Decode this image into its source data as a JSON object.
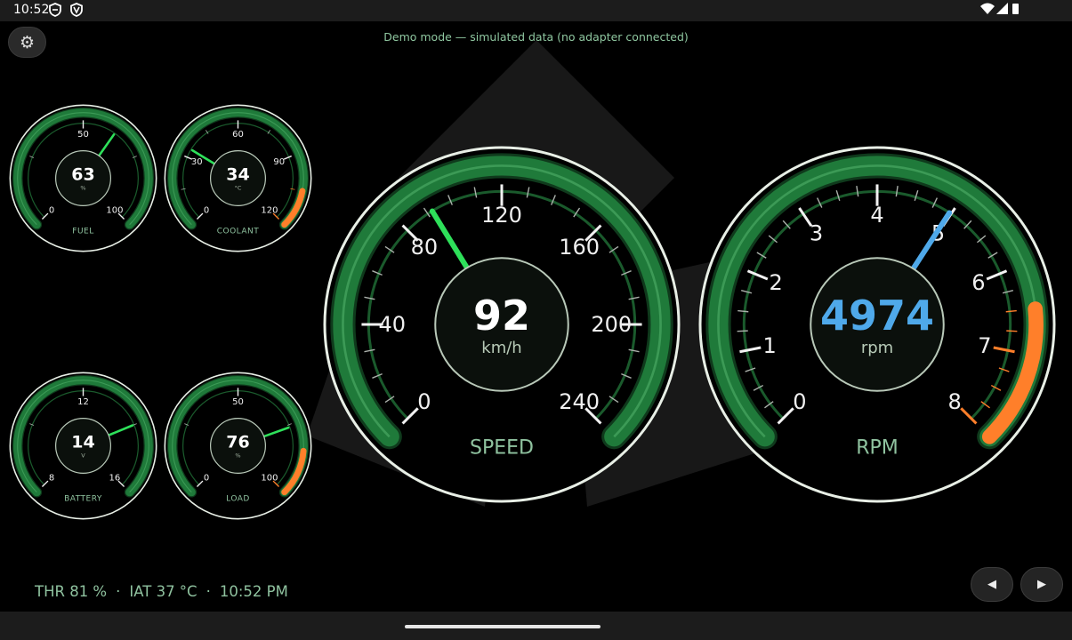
{
  "status_bar": {
    "time": "10:52",
    "icons": [
      "shield-icon",
      "vpn-icon",
      "wifi-icon",
      "signal-icon",
      "battery-icon"
    ]
  },
  "banner": "Demo mode — simulated data (no adapter connected)",
  "settings_button": {
    "icon": "gear-icon",
    "glyph": "⚙"
  },
  "gauges": {
    "fuel": {
      "label": "FUEL",
      "value": "63",
      "unit": "%",
      "min": 0,
      "max": 100,
      "needle": 63,
      "tick_labels": [
        {
          "v": 0,
          "t": "0"
        },
        {
          "v": 50,
          "t": "50"
        },
        {
          "v": 100,
          "t": "100"
        }
      ],
      "redzone": null
    },
    "coolant": {
      "label": "COOLANT",
      "value": "34",
      "unit": "°C",
      "min": 0,
      "max": 120,
      "needle": 34,
      "tick_labels": [
        {
          "v": 0,
          "t": "0"
        },
        {
          "v": 30,
          "t": "30"
        },
        {
          "v": 60,
          "t": "60"
        },
        {
          "v": 90,
          "t": "90"
        },
        {
          "v": 120,
          "t": "120"
        }
      ],
      "redzone": [
        105,
        120
      ]
    },
    "battery": {
      "label": "BATTERY",
      "value": "14",
      "unit": "V",
      "min": 8,
      "max": 16,
      "needle": 14,
      "tick_labels": [
        {
          "v": 8,
          "t": "8"
        },
        {
          "v": 12,
          "t": "12"
        },
        {
          "v": 16,
          "t": "16"
        }
      ],
      "redzone": null
    },
    "load": {
      "label": "LOAD",
      "value": "76",
      "unit": "%",
      "min": 0,
      "max": 100,
      "needle": 76,
      "tick_labels": [
        {
          "v": 0,
          "t": "0"
        },
        {
          "v": 50,
          "t": "50"
        },
        {
          "v": 100,
          "t": "100"
        }
      ],
      "redzone": [
        85,
        100
      ]
    },
    "speed": {
      "label": "SPEED",
      "value": "92",
      "unit": "km/h",
      "min": 0,
      "max": 240,
      "needle": 92,
      "tick_labels": [
        {
          "v": 0,
          "t": "0"
        },
        {
          "v": 40,
          "t": "40"
        },
        {
          "v": 80,
          "t": "80"
        },
        {
          "v": 120,
          "t": "120"
        },
        {
          "v": 160,
          "t": "160"
        },
        {
          "v": 200,
          "t": "200"
        },
        {
          "v": 240,
          "t": "240"
        }
      ],
      "redzone": null
    },
    "rpm": {
      "label": "RPM",
      "value": "4974",
      "unit": "rpm",
      "min": 0,
      "max": 8,
      "needle": 4.974,
      "tick_labels": [
        {
          "v": 0,
          "t": "0"
        },
        {
          "v": 1,
          "t": "1"
        },
        {
          "v": 2,
          "t": "2"
        },
        {
          "v": 3,
          "t": "3"
        },
        {
          "v": 4,
          "t": "4"
        },
        {
          "v": 5,
          "t": "5"
        },
        {
          "v": 6,
          "t": "6"
        },
        {
          "v": 7,
          "t": "7"
        },
        {
          "v": 8,
          "t": "8"
        }
      ],
      "redzone": [
        6.5,
        8
      ]
    }
  },
  "footer": {
    "throttle": "THR 81 %",
    "separator": "·",
    "intake_temp": "IAT 37 °C",
    "clock": "10:52 PM"
  },
  "nav": {
    "prev_glyph": "◀",
    "next_glyph": "▶"
  },
  "colors": {
    "ring": "#e8efe6",
    "arc": "#1f7a3a",
    "arc_dark": "#0f3a1c",
    "accent_green": "#2ee05a",
    "redzone": "#ff7f2a",
    "rpm_value": "#4fa9ea",
    "label_green": "#8fc29f"
  }
}
